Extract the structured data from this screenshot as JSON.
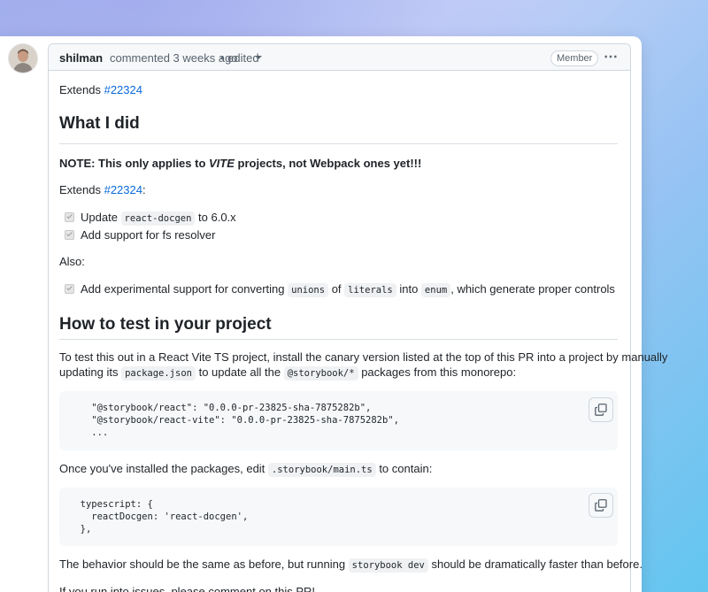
{
  "comment": {
    "author": "shilman",
    "meta": "commented 3 weeks ago",
    "edited": "• edited",
    "badge": "Member",
    "menu_icon": "kebab-horizontal-icon"
  },
  "body": {
    "intro_prefix": "Extends ",
    "intro_link": "#22324",
    "heading1": "What I did",
    "note_prefix": "NOTE: This only applies to ",
    "note_em": "VITE",
    "note_suffix": " projects, not Webpack ones yet!!!",
    "extends_prefix": "Extends ",
    "extends_link": "#22324",
    "extends_suffix": ":",
    "task1_prefix": "Update ",
    "task1_code": "react-docgen",
    "task1_suffix": " to 6.0.x",
    "task2": "Add support for fs resolver",
    "also": "Also:",
    "task3_a": "Add experimental support for converting ",
    "task3_code1": "unions",
    "task3_b": " of ",
    "task3_code2": "literals",
    "task3_c": " into ",
    "task3_code3": "enum",
    "task3_d": ", which generate proper controls",
    "heading2": "How to test in your project",
    "test_line1": "To test this out in a React Vite TS project, install the canary version listed at the top of this PR into a project by manually",
    "test_line2_a": "updating its ",
    "test_line2_code1": "package.json",
    "test_line2_b": " to update all the ",
    "test_line2_code2": "@storybook/*",
    "test_line2_c": " packages from this monorepo:",
    "code1": "    \"@storybook/react\": \"0.0.0-pr-23825-sha-7875282b\",\n    \"@storybook/react-vite\": \"0.0.0-pr-23825-sha-7875282b\",\n    ...",
    "installed_a": "Once you've installed the packages, edit ",
    "installed_code": ".storybook/main.ts",
    "installed_b": " to contain:",
    "code2": "  typescript: {\n    reactDocgen: 'react-docgen',\n  },",
    "behavior_a": "The behavior should be the same as before, but running ",
    "behavior_code": "storybook dev",
    "behavior_b": " should be dramatically faster than before.",
    "issues": "If you run into issues, please comment on this PR!"
  }
}
